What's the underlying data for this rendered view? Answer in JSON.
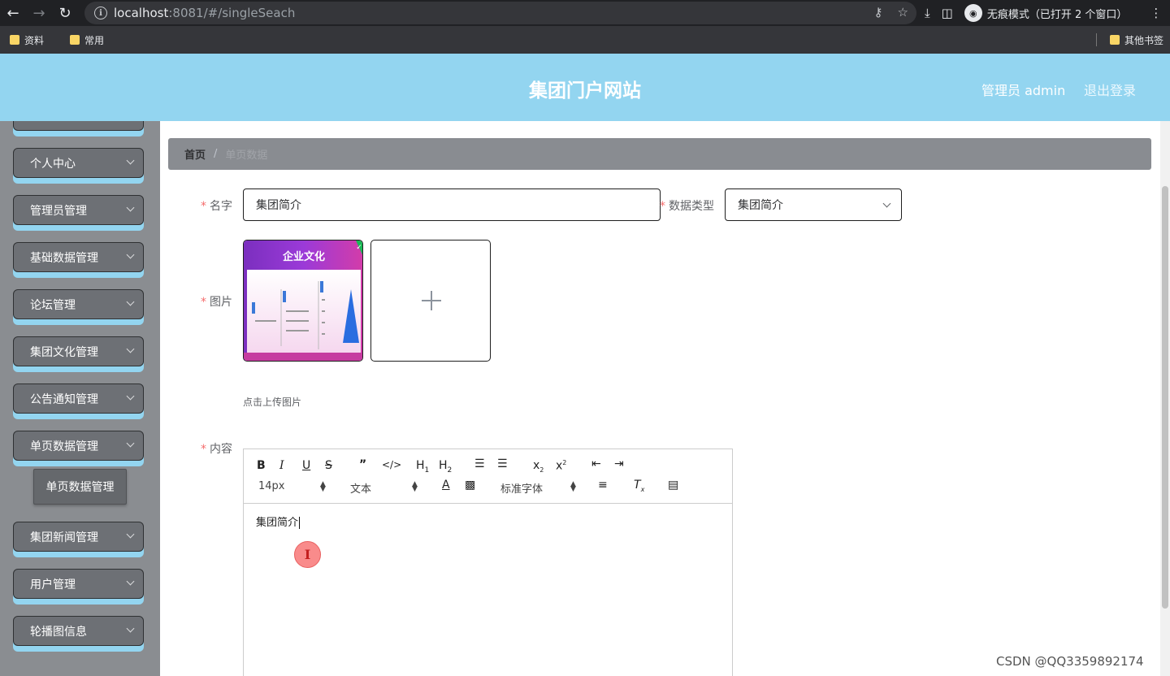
{
  "browser": {
    "url_host": "localhost",
    "url_rest": ":8081/#/singleSeach",
    "incognito_label": "无痕模式（已打开 2 个窗口）",
    "bookmarks": [
      "资料",
      "常用"
    ],
    "other_bookmarks": "其他书签"
  },
  "header": {
    "title": "集团门户网站",
    "admin": "管理员 admin",
    "logout": "退出登录",
    "color": "#93d5f0"
  },
  "sidebar": {
    "items": [
      {
        "label": "个人中心"
      },
      {
        "label": "管理员管理"
      },
      {
        "label": "基础数据管理"
      },
      {
        "label": "论坛管理"
      },
      {
        "label": "集团文化管理"
      },
      {
        "label": "公告通知管理"
      },
      {
        "label": "单页数据管理"
      },
      {
        "label": "集团新闻管理"
      },
      {
        "label": "用户管理"
      },
      {
        "label": "轮播图信息"
      }
    ],
    "submenu": "单页数据管理"
  },
  "breadcrumb": {
    "home": "首页",
    "separator": "/",
    "current": "单页数据"
  },
  "form": {
    "name_label": "名字",
    "name_value": "集团简介",
    "type_label": "数据类型",
    "type_value": "集团简介",
    "image_label": "图片",
    "image_caption": "企业文化",
    "upload_tip": "点击上传图片",
    "content_label": "内容"
  },
  "editor": {
    "font_size": "14px",
    "header_select": "文本",
    "font_family": "标准字体",
    "content": "集团简介"
  },
  "watermark": "CSDN @QQ3359892174"
}
